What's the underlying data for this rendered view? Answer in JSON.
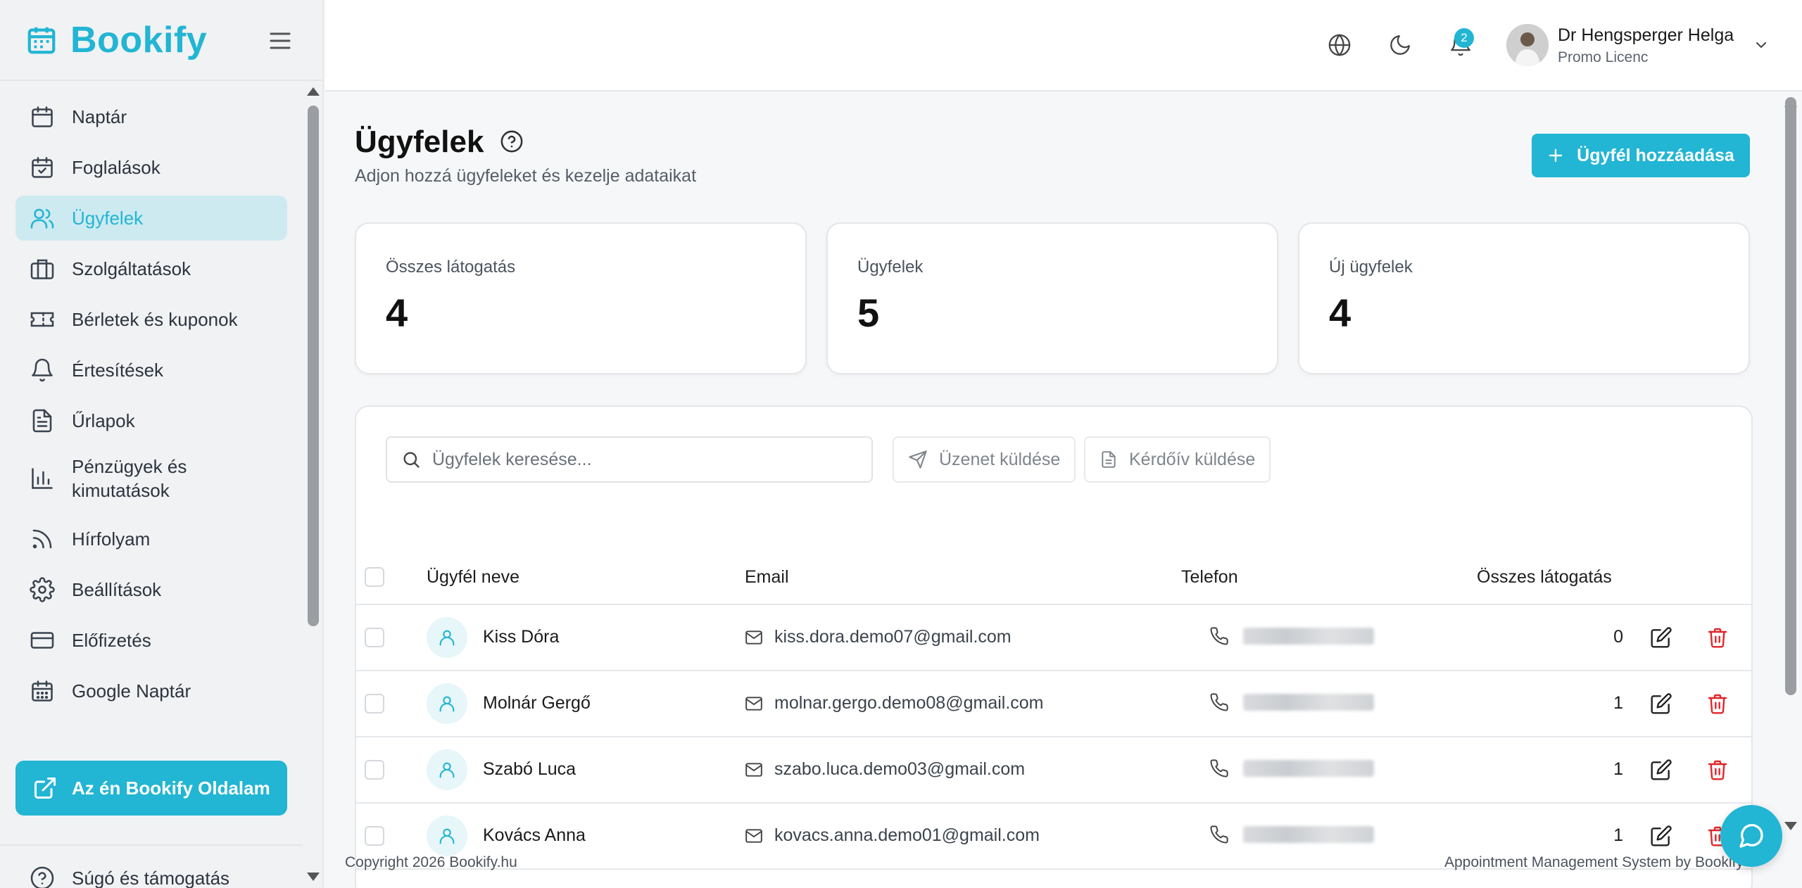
{
  "app": {
    "name": "Bookify"
  },
  "sidebar": {
    "items": [
      {
        "label": "Naptár",
        "icon": "calendar-icon"
      },
      {
        "label": "Foglalások",
        "icon": "calendar-check-icon"
      },
      {
        "label": "Ügyfelek",
        "icon": "users-icon",
        "active": true
      },
      {
        "label": "Szolgáltatások",
        "icon": "briefcase-icon"
      },
      {
        "label": "Bérletek és kuponok",
        "icon": "ticket-icon"
      },
      {
        "label": "Értesítések",
        "icon": "bell-icon"
      },
      {
        "label": "Űrlapok",
        "icon": "file-text-icon"
      },
      {
        "label": "Pénzügyek és kimutatások",
        "icon": "bar-chart-icon"
      },
      {
        "label": "Hírfolyam",
        "icon": "rss-icon"
      },
      {
        "label": "Beállítások",
        "icon": "gear-icon"
      },
      {
        "label": "Előfizetés",
        "icon": "credit-card-icon"
      },
      {
        "label": "Google Naptár",
        "icon": "calendar-grid-icon"
      }
    ],
    "page_button": "Az én Bookify Oldalam",
    "help": "Súgó és támogatás"
  },
  "header": {
    "notifications_count": "2",
    "user": {
      "name": "Dr Hengsperger Helga",
      "plan": "Promo Licenc"
    }
  },
  "page": {
    "title": "Ügyfelek",
    "subtitle": "Adjon hozzá ügyfeleket és kezelje adataikat",
    "add_button": "Ügyfél hozzáadása"
  },
  "stats": [
    {
      "label": "Összes látogatás",
      "value": "4"
    },
    {
      "label": "Ügyfelek",
      "value": "5"
    },
    {
      "label": "Új ügyfelek",
      "value": "4"
    }
  ],
  "toolbar": {
    "search_placeholder": "Ügyfelek keresése...",
    "send_message": "Üzenet küldése",
    "send_form": "Kérdőív küldése"
  },
  "table": {
    "columns": [
      "Ügyfél neve",
      "Email",
      "Telefon",
      "Összes látogatás"
    ],
    "rows": [
      {
        "name": "Kiss Dóra",
        "email": "kiss.dora.demo07@gmail.com",
        "visits": "0"
      },
      {
        "name": "Molnár Gergő",
        "email": "molnar.gergo.demo08@gmail.com",
        "visits": "1"
      },
      {
        "name": "Szabó Luca",
        "email": "szabo.luca.demo03@gmail.com",
        "visits": "1"
      },
      {
        "name": "Kovács Anna",
        "email": "kovacs.anna.demo01@gmail.com",
        "visits": "1"
      }
    ]
  },
  "footer": {
    "copyright": "Copyright 2026 Bookify.hu",
    "tagline": "Appointment Management System by Bookify"
  },
  "colors": {
    "accent": "#22b5d4",
    "delete": "#e0262b",
    "active_bg": "#cdeaf1"
  }
}
